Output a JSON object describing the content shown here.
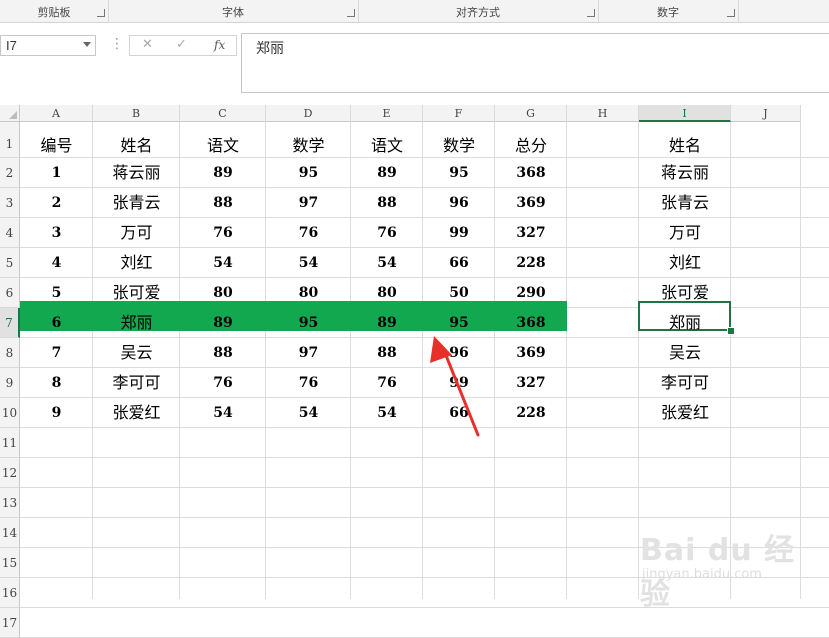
{
  "ribbon": {
    "groups": [
      "剪贴板",
      "字体",
      "对齐方式",
      "数字"
    ]
  },
  "formula_bar": {
    "name_box": "I7",
    "cancel_symbol": "✕",
    "enter_symbol": "✓",
    "fx_label": "fx",
    "value": "郑丽"
  },
  "sheet": {
    "column_headers": [
      "A",
      "B",
      "C",
      "D",
      "E",
      "F",
      "G",
      "H",
      "I",
      "J"
    ],
    "row_headers": [
      "1",
      "2",
      "3",
      "4",
      "5",
      "6",
      "7",
      "8",
      "9",
      "10",
      "11",
      "12",
      "13",
      "14",
      "15",
      "16",
      "17"
    ],
    "selected_column": "I",
    "selected_row": "7",
    "header_row": [
      "编号",
      "姓名",
      "语文",
      "数学",
      "语文",
      "数学",
      "总分"
    ],
    "rows": [
      [
        "1",
        "蒋云丽",
        "89",
        "95",
        "89",
        "95",
        "368"
      ],
      [
        "2",
        "张青云",
        "88",
        "97",
        "88",
        "96",
        "369"
      ],
      [
        "3",
        "万可",
        "76",
        "76",
        "76",
        "99",
        "327"
      ],
      [
        "4",
        "刘红",
        "54",
        "54",
        "54",
        "66",
        "228"
      ],
      [
        "5",
        "张可爱",
        "80",
        "80",
        "80",
        "50",
        "290"
      ],
      [
        "6",
        "郑丽",
        "89",
        "95",
        "89",
        "95",
        "368"
      ],
      [
        "7",
        "吴云",
        "88",
        "97",
        "88",
        "96",
        "369"
      ],
      [
        "8",
        "李可可",
        "76",
        "76",
        "76",
        "99",
        "327"
      ],
      [
        "9",
        "张爱红",
        "54",
        "54",
        "54",
        "66",
        "228"
      ]
    ],
    "highlight_color": "#11a84f",
    "column_i_header": "姓名",
    "column_i_values": [
      "蒋云丽",
      "张青云",
      "万可",
      "刘红",
      "张可爱",
      "郑丽",
      "吴云",
      "李可可",
      "张爱红"
    ]
  },
  "annotation": {
    "arrow_color": "#e8302a"
  },
  "watermark": {
    "main": "Bai du 经验",
    "sub": "jingyan.baidu.com"
  }
}
